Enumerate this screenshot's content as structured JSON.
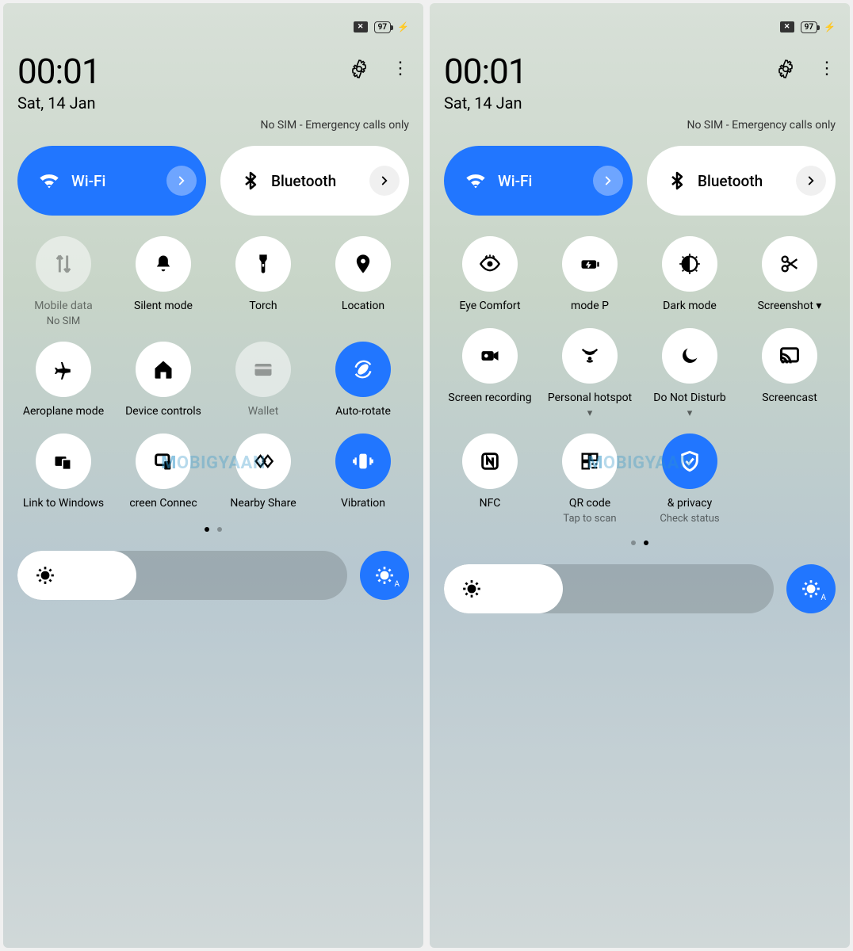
{
  "status": {
    "battery": "97"
  },
  "header": {
    "time": "00:01",
    "date": "Sat, 14 Jan",
    "sim_message": "No SIM - Emergency calls only"
  },
  "primary": {
    "wifi": {
      "label": "Wi-Fi",
      "on": true
    },
    "bluetooth": {
      "label": "Bluetooth",
      "on": false
    }
  },
  "panels": [
    {
      "brightness_fill_percent": 36,
      "page_dots": {
        "count": 2,
        "active": 0
      },
      "tiles": [
        {
          "id": "mobile-data",
          "icon": "data",
          "label": "Mobile data",
          "sublabel": "No SIM",
          "state": "dim"
        },
        {
          "id": "silent-mode",
          "icon": "bell",
          "label": "Silent mode",
          "state": "off"
        },
        {
          "id": "torch",
          "icon": "torch",
          "label": "Torch",
          "state": "off"
        },
        {
          "id": "location",
          "icon": "pin",
          "label": "Location",
          "state": "off"
        },
        {
          "id": "aeroplane-mode",
          "icon": "plane",
          "label": "Aeroplane mode",
          "state": "off"
        },
        {
          "id": "device-controls",
          "icon": "home",
          "label": "Device controls",
          "state": "off"
        },
        {
          "id": "wallet",
          "icon": "card",
          "label": "Wallet",
          "state": "dim"
        },
        {
          "id": "auto-rotate",
          "icon": "rotate",
          "label": "Auto-rotate",
          "state": "active"
        },
        {
          "id": "link-to-windows",
          "icon": "link",
          "label": "Link to Windows",
          "state": "off"
        },
        {
          "id": "screen-connect",
          "icon": "screen-conn",
          "label": "creen Connec",
          "state": "off"
        },
        {
          "id": "nearby-share",
          "icon": "nearby",
          "label": "Nearby Share",
          "state": "off"
        },
        {
          "id": "vibration",
          "icon": "vibrate",
          "label": "Vibration",
          "state": "active"
        }
      ]
    },
    {
      "brightness_fill_percent": 36,
      "page_dots": {
        "count": 2,
        "active": 1
      },
      "tiles": [
        {
          "id": "eye-comfort",
          "icon": "eye",
          "label": "Eye Comfort",
          "state": "off"
        },
        {
          "id": "power-mode",
          "icon": "battery-mode",
          "label": "mode    P",
          "state": "off"
        },
        {
          "id": "dark-mode",
          "icon": "dark",
          "label": "Dark mode",
          "state": "off"
        },
        {
          "id": "screenshot",
          "icon": "scissors",
          "label": "Screenshot ▾",
          "state": "off"
        },
        {
          "id": "screen-recording",
          "icon": "videocam",
          "label": "Screen recording",
          "state": "off"
        },
        {
          "id": "personal-hotspot",
          "icon": "hotspot",
          "label": "Personal hotspot",
          "sublabel": "▾",
          "state": "off"
        },
        {
          "id": "do-not-disturb",
          "icon": "moon",
          "label": "Do Not Disturb",
          "sublabel": "▾",
          "state": "off"
        },
        {
          "id": "screencast",
          "icon": "cast",
          "label": "Screencast",
          "state": "off"
        },
        {
          "id": "nfc",
          "icon": "nfc",
          "label": "NFC",
          "state": "off"
        },
        {
          "id": "qr-code",
          "icon": "qr",
          "label": "QR code",
          "sublabel": "Tap to scan",
          "state": "off"
        },
        {
          "id": "security-privacy",
          "icon": "shield",
          "label": "& privacy",
          "sublabel": "Check status",
          "state": "active"
        }
      ]
    }
  ],
  "watermark": "MOBIGYAAN"
}
